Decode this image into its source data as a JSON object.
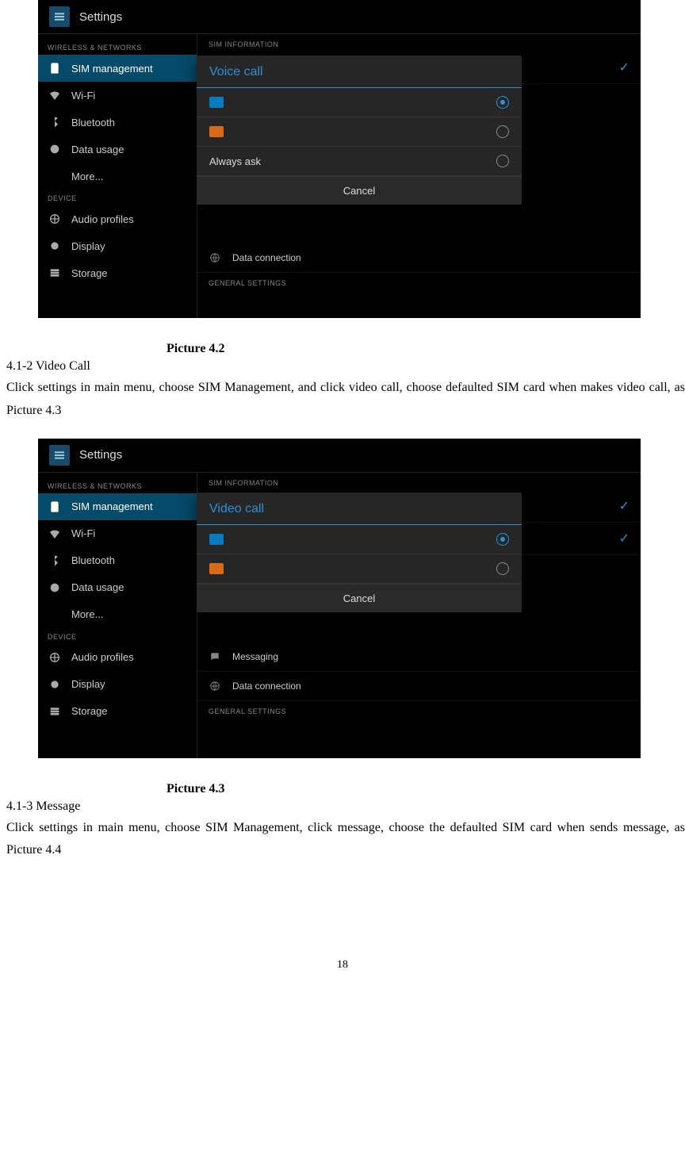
{
  "page_number": "18",
  "shot1": {
    "title": "Settings",
    "wireless_header": "WIRELESS & NETWORKS",
    "device_header": "DEVICE",
    "sidebar": {
      "sim": "SIM management",
      "wifi": "Wi-Fi",
      "bt": "Bluetooth",
      "data": "Data usage",
      "more": "More...",
      "audio": "Audio profiles",
      "display": "Display",
      "storage": "Storage"
    },
    "right": {
      "sim_info_header": "SIM INFORMATION",
      "data_connection": "Data connection",
      "general_header": "GENERAL SETTINGS"
    },
    "dialog": {
      "title": "Voice call",
      "always_ask": "Always ask",
      "cancel": "Cancel"
    }
  },
  "caption1": "Picture 4.2",
  "section1_title": "4.1-2 Video Call",
  "section1_body": "Click settings in main menu, choose SIM Management, and click video call, choose defaulted SIM card when makes video call, as Picture 4.3",
  "shot2": {
    "title": "Settings",
    "wireless_header": "WIRELESS & NETWORKS",
    "device_header": "DEVICE",
    "sidebar": {
      "sim": "SIM management",
      "wifi": "Wi-Fi",
      "bt": "Bluetooth",
      "data": "Data usage",
      "more": "More...",
      "audio": "Audio profiles",
      "display": "Display",
      "storage": "Storage"
    },
    "right": {
      "sim_info_header": "SIM INFORMATION",
      "messaging": "Messaging",
      "data_connection": "Data connection",
      "general_header": "GENERAL SETTINGS"
    },
    "dialog": {
      "title": "Video call",
      "cancel": "Cancel"
    }
  },
  "caption2": "Picture 4.3",
  "section2_title": "4.1-3 Message",
  "section2_body": "Click settings in main menu, choose SIM Management, click message, choose the defaulted SIM card when sends message, as Picture 4.4"
}
